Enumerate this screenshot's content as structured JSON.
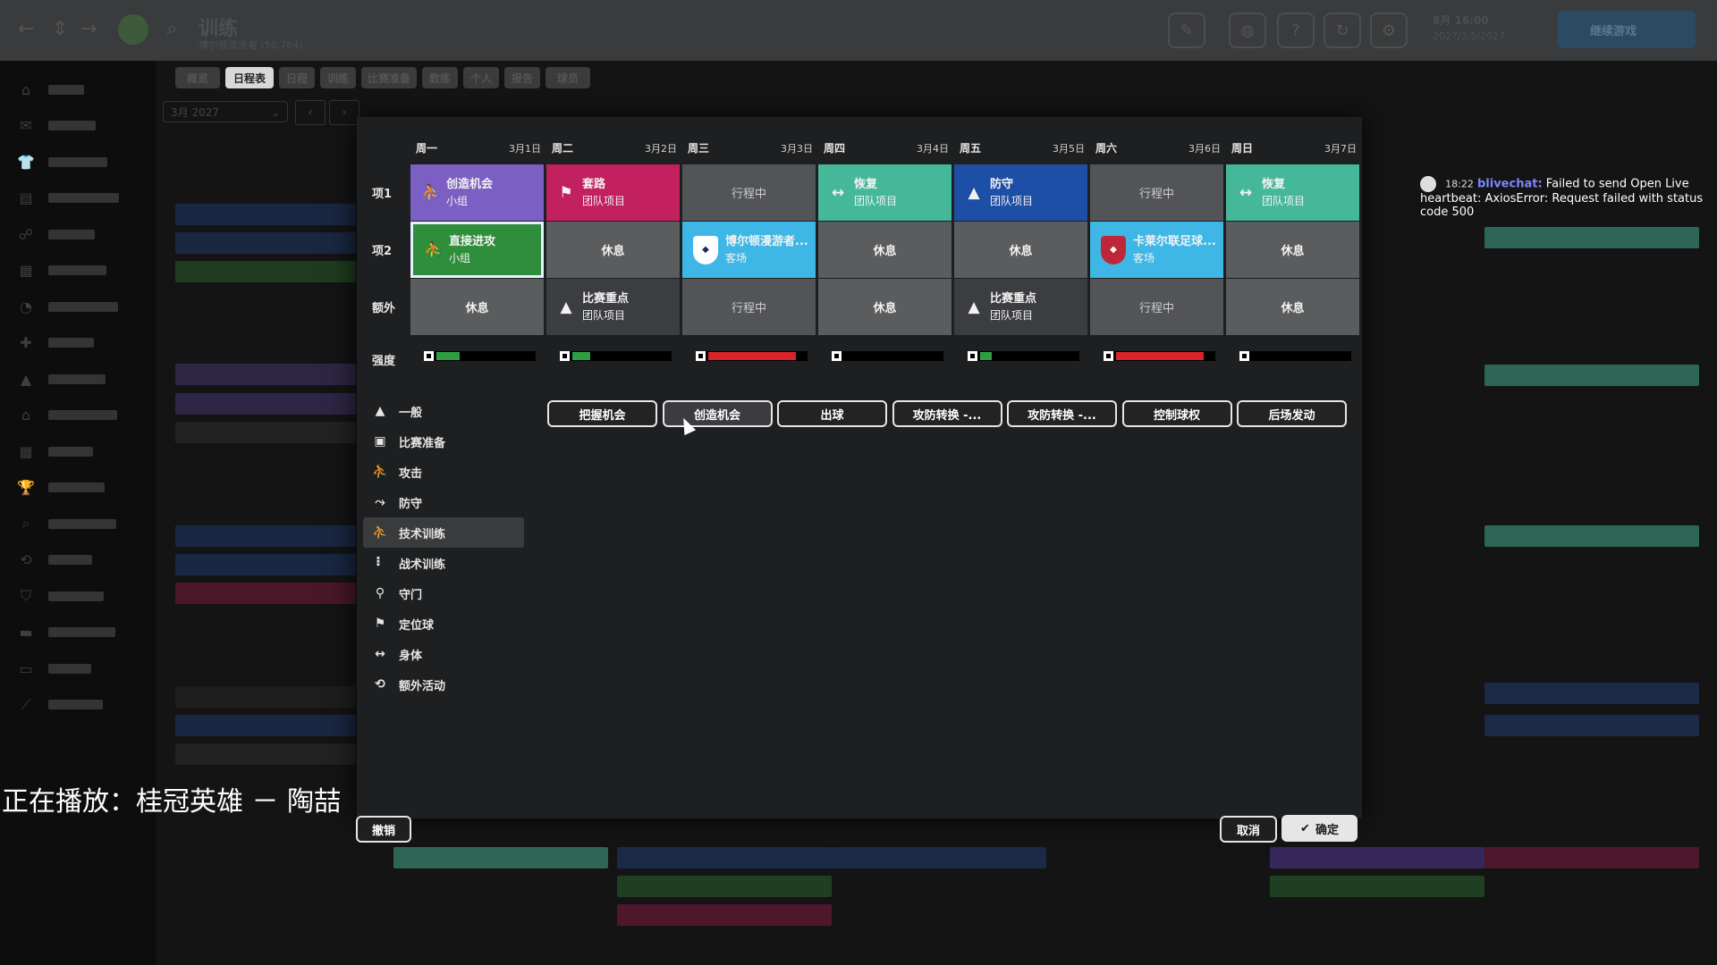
{
  "topbar": {
    "title": "训练",
    "subtitle": "博尔顿流浪者 (50,764)",
    "icons": [
      "back-icon",
      "up-down-icon",
      "forward-icon",
      "club-crest-icon",
      "search-icon"
    ],
    "date_line1": "8月 16:00",
    "date_line2": "2027/3/5/2027",
    "continue_label": "继续游戏"
  },
  "sidebar": {
    "items": [
      {
        "icon": "home-icon",
        "glyph": "⌂"
      },
      {
        "icon": "inbox-icon",
        "glyph": "✉"
      },
      {
        "icon": "squad-icon",
        "glyph": "👕"
      },
      {
        "icon": "dynamics-icon",
        "glyph": "▤"
      },
      {
        "icon": "staff-icon",
        "glyph": "☍"
      },
      {
        "icon": "tactics-icon",
        "glyph": "▦"
      },
      {
        "icon": "data-hub-icon",
        "glyph": "◔"
      },
      {
        "icon": "medical-icon",
        "glyph": "✚"
      },
      {
        "icon": "training-icon",
        "glyph": "▲"
      },
      {
        "icon": "development-icon",
        "glyph": "⌂"
      },
      {
        "icon": "schedule-icon",
        "glyph": "▦"
      },
      {
        "icon": "competitions-icon",
        "glyph": "🏆"
      },
      {
        "icon": "scouting-icon",
        "glyph": "⌕"
      },
      {
        "icon": "transfers-icon",
        "glyph": "⟲"
      },
      {
        "icon": "club-vision-icon",
        "glyph": "⛉"
      },
      {
        "icon": "finances-icon",
        "glyph": "▬"
      },
      {
        "icon": "report-icon",
        "glyph": "▭"
      },
      {
        "icon": "dev-centre-icon",
        "glyph": "⟋"
      }
    ]
  },
  "tabs": [
    "概览",
    "日程表",
    "日程",
    "训练",
    "比赛准备",
    "教练",
    "个人",
    "报告",
    "球员"
  ],
  "month_selector": {
    "value": "3月 2027"
  },
  "modal": {
    "days": [
      {
        "name": "周一",
        "date": "3月1日"
      },
      {
        "name": "周二",
        "date": "3月2日"
      },
      {
        "name": "周三",
        "date": "3月3日"
      },
      {
        "name": "周四",
        "date": "3月4日"
      },
      {
        "name": "周五",
        "date": "3月5日"
      },
      {
        "name": "周六",
        "date": "3月6日"
      },
      {
        "name": "周日",
        "date": "3月7日"
      }
    ],
    "row_labels": [
      "项1",
      "项2",
      "额外"
    ],
    "rows": [
      [
        {
          "style": "session",
          "color": "#7b5fc2",
          "icon": "attack-icon",
          "glyph": "⛹",
          "title": "创造机会",
          "sub": "小组"
        },
        {
          "style": "session",
          "color": "#c2205f",
          "icon": "set-piece-icon",
          "glyph": "⚑",
          "title": "套路",
          "sub": "团队项目"
        },
        {
          "style": "travel",
          "title": "行程中"
        },
        {
          "style": "session",
          "color": "#46b89a",
          "icon": "physical-icon",
          "glyph": "↔",
          "title": "恢复",
          "sub": "团队项目"
        },
        {
          "style": "session",
          "color": "#1e4fa6",
          "icon": "general-icon",
          "glyph": "▲",
          "title": "防守",
          "sub": "团队项目"
        },
        {
          "style": "travel",
          "title": "行程中"
        },
        {
          "style": "session",
          "color": "#46b89a",
          "icon": "physical-icon",
          "glyph": "↔",
          "title": "恢复",
          "sub": "团队项目"
        }
      ],
      [
        {
          "style": "session",
          "color": "#2f8e3b",
          "icon": "attack-icon",
          "glyph": "⛹",
          "title": "直接进攻",
          "sub": "小组",
          "selected": true
        },
        {
          "style": "gray",
          "title": "休息"
        },
        {
          "style": "match",
          "color": "#3fb7e6",
          "crest_color": "#ffffff",
          "crest_text": "BWFC",
          "title": "博尔顿漫游者...",
          "sub": "客场"
        },
        {
          "style": "gray",
          "title": "休息"
        },
        {
          "style": "gray",
          "title": "休息"
        },
        {
          "style": "match",
          "color": "#3fb7e6",
          "crest_color": "#c0263a",
          "crest_text": "CCFC",
          "title": "卡莱尔联足球...",
          "sub": "客场"
        },
        {
          "style": "gray",
          "title": "休息"
        }
      ],
      [
        {
          "style": "gray",
          "title": "休息"
        },
        {
          "style": "session",
          "color": "#3b3d40",
          "icon": "general-icon",
          "glyph": "▲",
          "title": "比赛重点",
          "sub": "团队项目"
        },
        {
          "style": "travel",
          "title": "行程中"
        },
        {
          "style": "gray",
          "title": "休息"
        },
        {
          "style": "session",
          "color": "#3b3d40",
          "icon": "general-icon",
          "glyph": "▲",
          "title": "比赛重点",
          "sub": "团队项目"
        },
        {
          "style": "travel",
          "title": "行程中"
        },
        {
          "style": "gray",
          "title": "休息"
        }
      ]
    ],
    "intensity_label": "强度",
    "intensity": [
      {
        "level": 0.23,
        "color": "#2e9e44"
      },
      {
        "level": 0.18,
        "color": "#2e9e44"
      },
      {
        "level": 0.88,
        "color": "#d8232a"
      },
      {
        "level": 0,
        "color": "#2e9e44"
      },
      {
        "level": 0.12,
        "color": "#2e9e44"
      },
      {
        "level": 0.88,
        "color": "#d8232a"
      },
      {
        "level": 0,
        "color": "#2e9e44"
      }
    ],
    "categories": [
      {
        "label": "一般",
        "icon": "general-icon",
        "glyph": "▲"
      },
      {
        "label": "比赛准备",
        "icon": "match-prep-icon",
        "glyph": "▣"
      },
      {
        "label": "攻击",
        "icon": "attack-icon",
        "glyph": "⛹"
      },
      {
        "label": "防守",
        "icon": "defence-icon",
        "glyph": "⤳"
      },
      {
        "label": "技术训练",
        "icon": "technical-icon",
        "glyph": "⛹",
        "active": true
      },
      {
        "label": "战术训练",
        "icon": "tactical-icon",
        "glyph": "⠇"
      },
      {
        "label": "守门",
        "icon": "goalkeeping-icon",
        "glyph": "⚲"
      },
      {
        "label": "定位球",
        "icon": "set-piece-icon",
        "glyph": "⚑"
      },
      {
        "label": "身体",
        "icon": "physical-icon",
        "glyph": "↔"
      },
      {
        "label": "额外活动",
        "icon": "extra-icon",
        "glyph": "⟲"
      }
    ],
    "sessions": [
      "把握机会",
      "创造机会",
      "出球",
      "攻防转换 -...",
      "攻防转换 -...",
      "控制球权",
      "后场发动"
    ],
    "hovered_session_index": 1,
    "undo_label": "撤销",
    "cancel_label": "取消",
    "confirm_label": "确定"
  },
  "notification": {
    "time": "18:22",
    "user": "blivechat:",
    "message": "Failed to send Open Live heartbeat: AxiosError: Request failed with status code 500"
  },
  "now_playing": "正在播放：桂冠英雄 － 陶喆"
}
